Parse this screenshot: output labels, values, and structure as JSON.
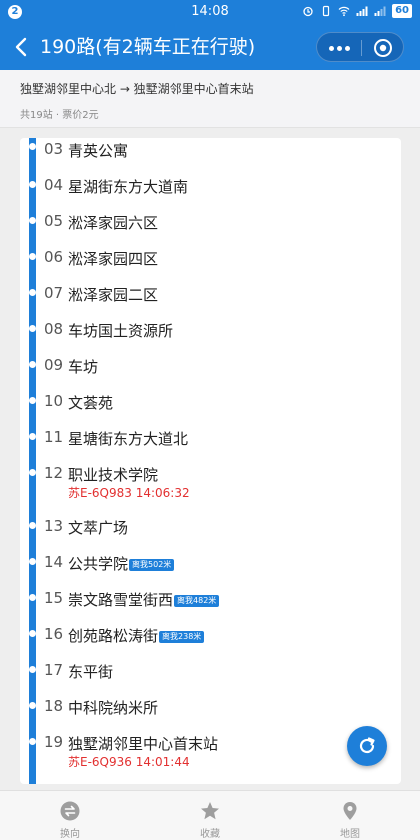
{
  "status_bar": {
    "badge": "2",
    "time": "14:08",
    "battery": "60"
  },
  "header": {
    "title": "190路(有2辆车正在行驶)"
  },
  "route": {
    "direction": "独墅湖邻里中心北 → 独墅湖邻里中心首末站",
    "meta": "共19站 · 票价2元"
  },
  "stations": [
    {
      "num": "03",
      "name": "青英公寓"
    },
    {
      "num": "04",
      "name": "星湖街东方大道南"
    },
    {
      "num": "05",
      "name": "淞泽家园六区"
    },
    {
      "num": "06",
      "name": "淞泽家园四区"
    },
    {
      "num": "07",
      "name": "淞泽家园二区"
    },
    {
      "num": "08",
      "name": "车坊国土资源所"
    },
    {
      "num": "09",
      "name": "车坊"
    },
    {
      "num": "10",
      "name": "文荟苑"
    },
    {
      "num": "11",
      "name": "星塘街东方大道北"
    },
    {
      "num": "12",
      "name": "职业技术学院",
      "bus": "苏E-6Q983   14:06:32"
    },
    {
      "num": "13",
      "name": "文萃广场"
    },
    {
      "num": "14",
      "name": "公共学院",
      "distance": "离我502米"
    },
    {
      "num": "15",
      "name": "崇文路雪堂街西",
      "distance": "离我482米"
    },
    {
      "num": "16",
      "name": "创苑路松涛街",
      "distance": "离我238米"
    },
    {
      "num": "17",
      "name": "东平街"
    },
    {
      "num": "18",
      "name": "中科院纳米所"
    },
    {
      "num": "19",
      "name": "独墅湖邻里中心首末站",
      "bus": "苏E-6Q936   14:01:44"
    }
  ],
  "tabs": [
    {
      "label": "换向",
      "icon": "swap-icon"
    },
    {
      "label": "收藏",
      "icon": "star-icon"
    },
    {
      "label": "地图",
      "icon": "map-pin-icon"
    }
  ],
  "colors": {
    "primary": "#1e7fd9",
    "bus_text": "#e23030"
  }
}
